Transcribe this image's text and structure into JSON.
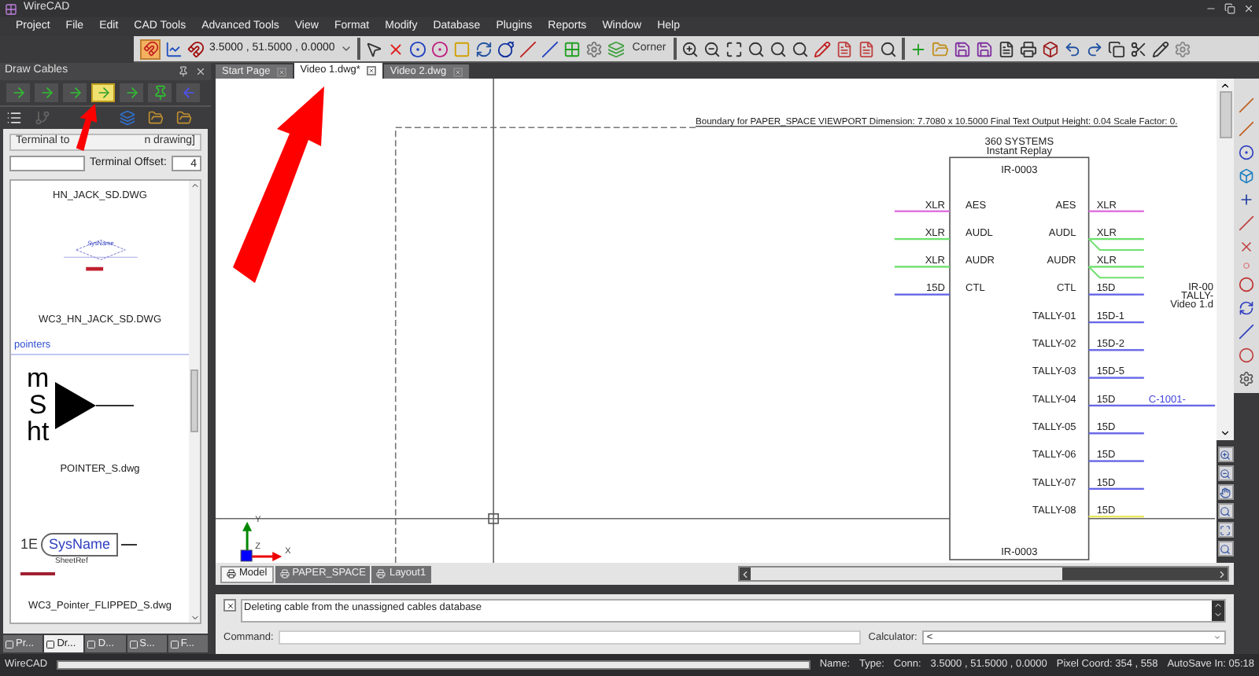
{
  "window": {
    "title": "WireCAD"
  },
  "menu": [
    "Project",
    "File",
    "Edit",
    "CAD Tools",
    "Advanced Tools",
    "View",
    "Format",
    "Modify",
    "Database",
    "Plugins",
    "Reports",
    "Window",
    "Help"
  ],
  "toolbar": {
    "snap_on": true,
    "coordinates": "3.5000 , 51.5000 , 0.0000",
    "corner_mode": "Corner"
  },
  "panel": {
    "title": "Draw Cables",
    "cable_tools": [
      {
        "selected": false
      },
      {
        "selected": false
      },
      {
        "selected": false
      },
      {
        "selected": true
      },
      {
        "selected": false
      },
      {
        "selected": false
      },
      {
        "selected": false
      }
    ],
    "tab_start": "Terminal to",
    "tab_end": "n drawing]",
    "offset_label": "Terminal Offset:",
    "offset_value": "4",
    "items": [
      {
        "kind": "caption",
        "text": "HN_JACK_SD.DWG"
      },
      {
        "kind": "jack",
        "label": "SysName"
      },
      {
        "kind": "caption",
        "text": "WC3_HN_JACK_SD.DWG"
      },
      {
        "kind": "section",
        "text": "pointers"
      },
      {
        "kind": "pointer",
        "letters": [
          "m",
          "S",
          "ht"
        ]
      },
      {
        "kind": "caption",
        "text": "POINTER_S.dwg"
      },
      {
        "kind": "flipped_pointer",
        "prefix": "1E",
        "label": "SysName",
        "sublabel": "SheetRef"
      },
      {
        "kind": "caption",
        "text": "WC3_Pointer_FLIPPED_S.dwg"
      }
    ],
    "bottom_tabs": [
      {
        "label": "Pr...",
        "selected": false
      },
      {
        "label": "Dr...",
        "selected": true
      },
      {
        "label": "D...",
        "selected": false
      },
      {
        "label": "S...",
        "selected": false
      },
      {
        "label": "F...",
        "selected": false
      }
    ]
  },
  "doc_tabs": [
    {
      "label": "Start Page",
      "selected": false
    },
    {
      "label": "Video 1.dwg*",
      "selected": true
    },
    {
      "label": "Video 2.dwg",
      "selected": false
    }
  ],
  "drawing": {
    "boundary_text": "Boundary for PAPER_SPACE VIEWPORT Dimension: 7.7080 x 10.5000 Final Text Output Height: 0.04  Scale Factor: 0.",
    "maker": "360 SYSTEMS",
    "model": "Instant Replay",
    "block_id": "IR-0003",
    "block_id_bottom": "IR-0003",
    "left_pins": [
      {
        "name": "AES",
        "connector": "XLR",
        "color": "#e070e0"
      },
      {
        "name": "AUDL",
        "connector": "XLR",
        "color": "#70e070"
      },
      {
        "name": "AUDR",
        "connector": "XLR",
        "color": "#70e070"
      },
      {
        "name": "CTL",
        "connector": "15D",
        "color": "#6868e8"
      }
    ],
    "right_pins": [
      {
        "name": "AES",
        "connector": "XLR",
        "color": "#e070e0",
        "split": false
      },
      {
        "name": "AUDL",
        "connector": "XLR",
        "color": "#70e070",
        "split": true
      },
      {
        "name": "AUDR",
        "connector": "XLR",
        "color": "#70e070",
        "split": true
      },
      {
        "name": "CTL",
        "connector": "15D",
        "color": "#6868e8",
        "split": false
      },
      {
        "name": "TALLY-01",
        "connector": "15D-1",
        "color": "#6868e8",
        "split": false
      },
      {
        "name": "TALLY-02",
        "connector": "15D-2",
        "color": "#6868e8",
        "split": false
      },
      {
        "name": "TALLY-03",
        "connector": "15D-5",
        "color": "#6868e8",
        "split": false
      },
      {
        "name": "TALLY-04",
        "connector": "15D",
        "color": "#6868e8",
        "split": false,
        "cable": "C-1001-"
      },
      {
        "name": "TALLY-05",
        "connector": "15D",
        "color": "#6868e8",
        "split": false
      },
      {
        "name": "TALLY-06",
        "connector": "15D",
        "color": "#6868e8",
        "split": false
      },
      {
        "name": "TALLY-07",
        "connector": "15D",
        "color": "#6868e8",
        "split": false
      },
      {
        "name": "TALLY-08",
        "connector": "15D",
        "color": "#e8e860",
        "split": false
      }
    ],
    "offpage_lines": [
      "IR-00",
      "TALLY-",
      "Video 1.d"
    ],
    "axis_labels": {
      "y": "Y",
      "z": "Z",
      "x": "X"
    }
  },
  "layout_tabs": [
    {
      "label": "Model",
      "selected": true
    },
    {
      "label": "PAPER_SPACE",
      "selected": false
    },
    {
      "label": "Layout1",
      "selected": false
    }
  ],
  "output": {
    "message": "Deleting cable from the unassigned cables database",
    "command_label": "Command:",
    "calculator_label": "Calculator:",
    "calculator_value": "<"
  },
  "status_bar": {
    "app": "WireCAD",
    "name_label": "Name:",
    "type_label": "Type:",
    "conn_label": "Conn:",
    "coordinates": "3.5000 , 51.5000 , 0.0000",
    "pixel_coord": "Pixel Coord: 354 , 558",
    "autosave": "AutoSave In: 05:18"
  }
}
